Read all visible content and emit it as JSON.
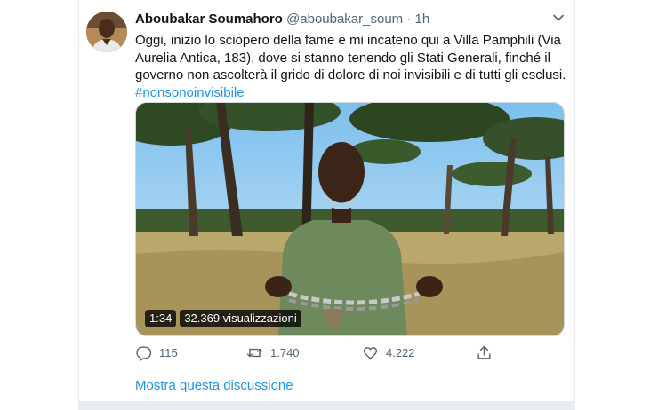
{
  "tweet": {
    "author_name": "Aboubakar Soumahoro",
    "handle": "@aboubakar_soum",
    "separator": "·",
    "time": "1h",
    "text": "Oggi, inizio lo sciopero della fame e mi incateno qui a Villa Pamphili (Via Aurelia Antica, 183), dove si stanno tenendo gli Stati Generali, finché il governo non ascolterà il grido di dolore di noi invisibili e di tutti gli esclusi.",
    "hashtag": "#nonsonoinvisibile",
    "video": {
      "duration": "1:34",
      "views": "32.369 visualizzazioni"
    },
    "actions": {
      "replies": "115",
      "retweets": "1.740",
      "likes": "4.222"
    },
    "thread_link": "Mostra questa discussione"
  },
  "icons": [
    "chevron-down-icon",
    "reply-icon",
    "retweet-icon",
    "like-icon",
    "share-icon"
  ],
  "colors": {
    "link": "#1b95e0",
    "text": "#0f1419",
    "muted": "#536471",
    "border": "#e6ecf0"
  }
}
